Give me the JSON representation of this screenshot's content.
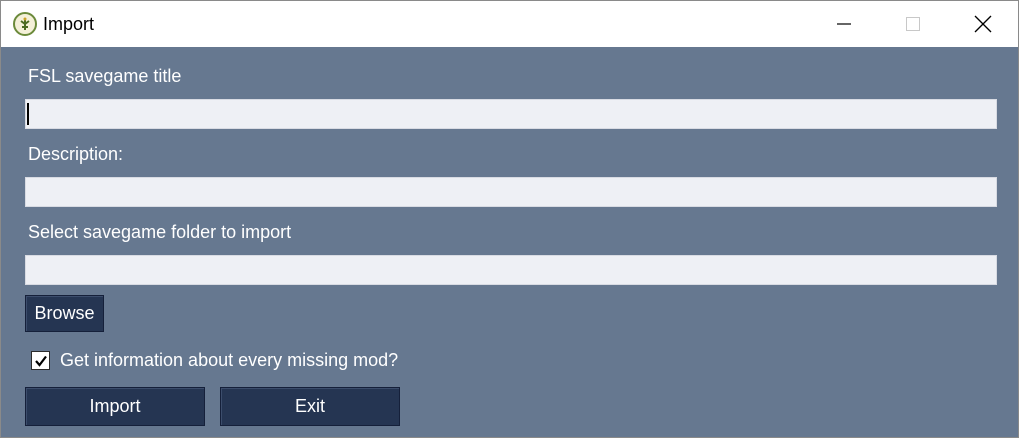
{
  "window": {
    "title": "Import",
    "icon": "app-tree-logo-icon",
    "controls": [
      "minimize-icon",
      "maximize-icon",
      "close-icon"
    ]
  },
  "form": {
    "title_label": "FSL savegame title",
    "title_value": "",
    "description_label": "Description:",
    "description_value": "",
    "folder_label": "Select savegame folder to import",
    "folder_value": "",
    "browse_label": "Browse",
    "missing_mods_label": "Get information about every missing mod?",
    "missing_mods_checked": true,
    "import_label": "Import",
    "exit_label": "Exit"
  },
  "colors": {
    "background": "#667890",
    "button": "#253552",
    "field": "#eef0f5",
    "text": "#ffffff"
  }
}
